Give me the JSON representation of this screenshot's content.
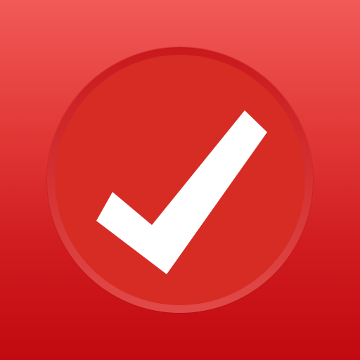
{
  "icon": {
    "name": "checkmark-icon",
    "colors": {
      "background_top": "#f15a58",
      "background_bottom": "#c10a10",
      "ring_top": "#c9191d",
      "ring_bottom": "#e04a48",
      "badge_face": "#d72c24",
      "checkmark": "#ffffff"
    }
  }
}
